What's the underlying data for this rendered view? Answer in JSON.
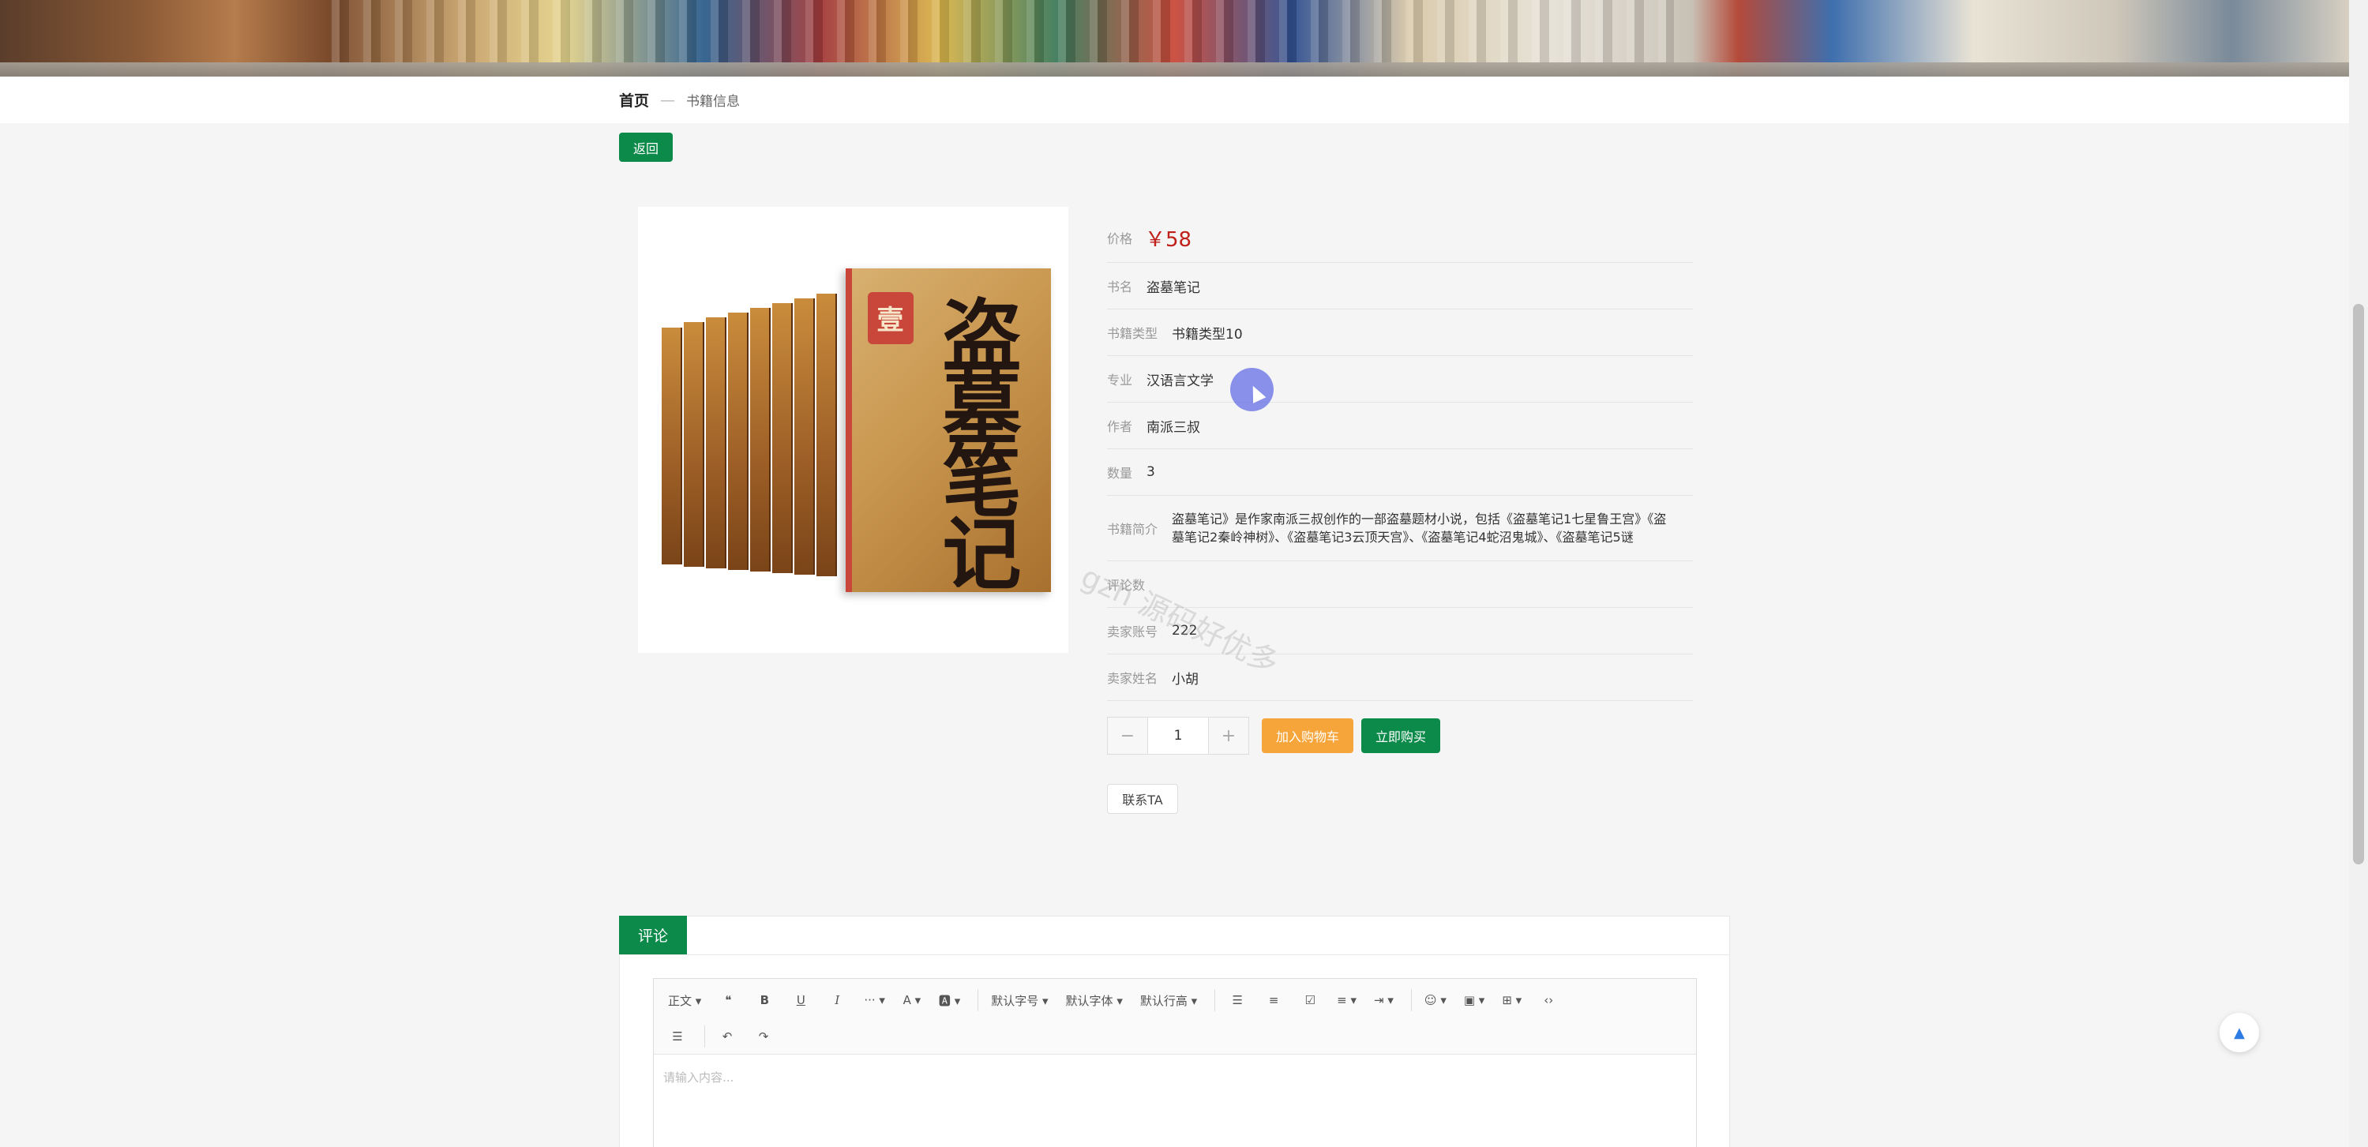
{
  "breadcrumb": {
    "home": "首页",
    "sep": "—",
    "current": "书籍信息"
  },
  "back_label": "返回",
  "book": {
    "cover_title": "盗墓笔记",
    "cover_volume": "壹",
    "price_label": "价格",
    "price": "￥58",
    "fields": [
      {
        "label": "书名",
        "value": "盗墓笔记"
      },
      {
        "label": "书籍类型",
        "value": "书籍类型10"
      },
      {
        "label": "专业",
        "value": "汉语言文学"
      },
      {
        "label": "作者",
        "value": "南派三叔"
      },
      {
        "label": "数量",
        "value": "3"
      }
    ],
    "intro_label": "书籍简介",
    "intro": "盗墓笔记》是作家南派三叔创作的一部盗墓题材小说，包括《盗墓笔记1七星鲁王宫》《盗墓笔记2秦岭神树》、《盗墓笔记3云顶天宫》、《盗墓笔记4蛇沼鬼城》、《盗墓笔记5谜",
    "fields2": [
      {
        "label": "评论数",
        "value": ""
      },
      {
        "label": "卖家账号",
        "value": "222"
      },
      {
        "label": "卖家姓名",
        "value": "小胡"
      }
    ]
  },
  "purchase": {
    "minus": "−",
    "quantity": "1",
    "plus": "+",
    "add_cart": "加入购物车",
    "buy_now": "立即购买",
    "contact": "联系TA"
  },
  "watermark": "gzh 源码好优多",
  "comments": {
    "tab": "评论",
    "toolbar_row1": [
      "正文 ▾",
      "❝",
      "B",
      "U",
      "I",
      "··· ▾",
      "A ▾",
      "🅰 ▾",
      "默认字号 ▾",
      "默认字体 ▾",
      "默认行高 ▾",
      "☰",
      "≡",
      "☑",
      "≡ ▾",
      "⇥ ▾",
      "☺ ▾",
      "▣ ▾",
      "⊞ ▾",
      "‹›"
    ],
    "toolbar_row2": [
      "☰",
      "↶",
      "↷"
    ],
    "placeholder": "请输入内容..."
  },
  "back_to_top": "▲",
  "colors": {
    "primary": "#0b8a4a",
    "accent": "#f5a53a",
    "price": "#c0201a"
  }
}
